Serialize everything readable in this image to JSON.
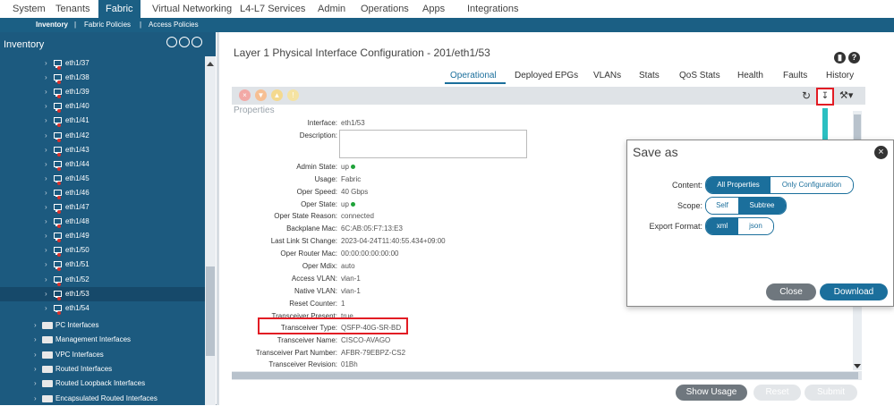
{
  "top_nav": {
    "tabs": [
      "System",
      "Tenants",
      "Fabric",
      "Virtual Networking",
      "L4-L7 Services",
      "Admin",
      "Operations",
      "Apps",
      "Integrations"
    ],
    "active": "Fabric"
  },
  "sub_nav": {
    "items": [
      "Inventory",
      "|",
      "Fabric Policies",
      "|",
      "Access Policies"
    ]
  },
  "sidebar": {
    "title": "Inventory",
    "interfaces": [
      "eth1/37",
      "eth1/38",
      "eth1/39",
      "eth1/40",
      "eth1/41",
      "eth1/42",
      "eth1/43",
      "eth1/44",
      "eth1/45",
      "eth1/46",
      "eth1/47",
      "eth1/48",
      "eth1/49",
      "eth1/50",
      "eth1/51",
      "eth1/52",
      "eth1/53",
      "eth1/54"
    ],
    "selected": "eth1/53",
    "folders": [
      "PC Interfaces",
      "Management Interfaces",
      "VPC Interfaces",
      "Routed Interfaces",
      "Routed Loopback Interfaces",
      "Encapsulated Routed Interfaces"
    ]
  },
  "panel": {
    "title": "Layer 1 Physical Interface Configuration - 201/eth1/53",
    "tabs": [
      "Operational",
      "Deployed EPGs",
      "VLANs",
      "Stats",
      "QoS Stats",
      "Health",
      "Faults",
      "History"
    ],
    "active_tab": "Operational",
    "section": "Properties",
    "properties": [
      {
        "label": "Interface:",
        "value": "eth1/53"
      },
      {
        "label": "Description:",
        "value": ""
      },
      {
        "label": "Admin State:",
        "value": "up"
      },
      {
        "label": "Usage:",
        "value": "Fabric"
      },
      {
        "label": "Oper Speed:",
        "value": "40 Gbps"
      },
      {
        "label": "Oper State:",
        "value": "up"
      },
      {
        "label": "Oper State Reason:",
        "value": "connected"
      },
      {
        "label": "Backplane Mac:",
        "value": "6C:AB:05:F7:13:E3"
      },
      {
        "label": "Last Link St Change:",
        "value": "2023-04-24T11:40:55.434+09:00"
      },
      {
        "label": "Oper Router Mac:",
        "value": "00:00:00:00:00:00"
      },
      {
        "label": "Oper Mdix:",
        "value": "auto"
      },
      {
        "label": "Access VLAN:",
        "value": "vlan-1"
      },
      {
        "label": "Native VLAN:",
        "value": "vlan-1"
      },
      {
        "label": "Reset Counter:",
        "value": "1"
      },
      {
        "label": "Transceiver Present:",
        "value": "true"
      },
      {
        "label": "Transceiver Type:",
        "value": "QSFP-40G-SR-BD"
      },
      {
        "label": "Transceiver Name:",
        "value": "CISCO-AVAGO"
      },
      {
        "label": "Transceiver Part Number:",
        "value": "AFBR-79EBPZ-CS2"
      },
      {
        "label": "Transceiver Revision:",
        "value": "01Bh"
      }
    ],
    "buttons": {
      "show_usage": "Show Usage",
      "reset": "Reset",
      "submit": "Submit"
    }
  },
  "dialog": {
    "title": "Save as",
    "content_label": "Content:",
    "content_options": [
      "All Properties",
      "Only Configuration"
    ],
    "content_selected": "All Properties",
    "scope_label": "Scope:",
    "scope_options": [
      "Self",
      "Subtree"
    ],
    "scope_selected": "Subtree",
    "format_label": "Export Format:",
    "format_options": [
      "xml",
      "json"
    ],
    "format_selected": "xml",
    "close_label": "Close",
    "download_label": "Download"
  },
  "colors": {
    "brand": "#1b5f84",
    "accent": "#1b6f9c",
    "highlight": "#e21c24",
    "arrow": "#2bbfc1",
    "status_up": "#1fa33a"
  },
  "icons": [
    "monitor-icon",
    "folder-icon",
    "chevron-right-icon",
    "refresh-icon",
    "download-icon",
    "tools-icon",
    "bookmark-icon",
    "help-icon",
    "close-icon"
  ]
}
